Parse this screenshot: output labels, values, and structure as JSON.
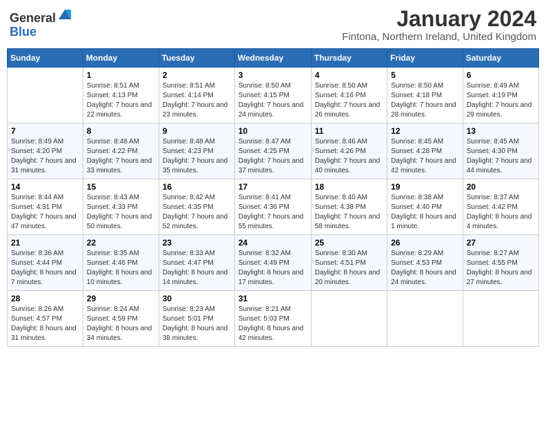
{
  "logo": {
    "text_general": "General",
    "text_blue": "Blue"
  },
  "header": {
    "month": "January 2024",
    "location": "Fintona, Northern Ireland, United Kingdom"
  },
  "weekdays": [
    "Sunday",
    "Monday",
    "Tuesday",
    "Wednesday",
    "Thursday",
    "Friday",
    "Saturday"
  ],
  "weeks": [
    [
      {
        "day": "",
        "sunrise": "",
        "sunset": "",
        "daylight": ""
      },
      {
        "day": "1",
        "sunrise": "Sunrise: 8:51 AM",
        "sunset": "Sunset: 4:13 PM",
        "daylight": "Daylight: 7 hours and 22 minutes."
      },
      {
        "day": "2",
        "sunrise": "Sunrise: 8:51 AM",
        "sunset": "Sunset: 4:14 PM",
        "daylight": "Daylight: 7 hours and 23 minutes."
      },
      {
        "day": "3",
        "sunrise": "Sunrise: 8:50 AM",
        "sunset": "Sunset: 4:15 PM",
        "daylight": "Daylight: 7 hours and 24 minutes."
      },
      {
        "day": "4",
        "sunrise": "Sunrise: 8:50 AM",
        "sunset": "Sunset: 4:16 PM",
        "daylight": "Daylight: 7 hours and 26 minutes."
      },
      {
        "day": "5",
        "sunrise": "Sunrise: 8:50 AM",
        "sunset": "Sunset: 4:18 PM",
        "daylight": "Daylight: 7 hours and 28 minutes."
      },
      {
        "day": "6",
        "sunrise": "Sunrise: 8:49 AM",
        "sunset": "Sunset: 4:19 PM",
        "daylight": "Daylight: 7 hours and 29 minutes."
      }
    ],
    [
      {
        "day": "7",
        "sunrise": "Sunrise: 8:49 AM",
        "sunset": "Sunset: 4:20 PM",
        "daylight": "Daylight: 7 hours and 31 minutes."
      },
      {
        "day": "8",
        "sunrise": "Sunrise: 8:48 AM",
        "sunset": "Sunset: 4:22 PM",
        "daylight": "Daylight: 7 hours and 33 minutes."
      },
      {
        "day": "9",
        "sunrise": "Sunrise: 8:48 AM",
        "sunset": "Sunset: 4:23 PM",
        "daylight": "Daylight: 7 hours and 35 minutes."
      },
      {
        "day": "10",
        "sunrise": "Sunrise: 8:47 AM",
        "sunset": "Sunset: 4:25 PM",
        "daylight": "Daylight: 7 hours and 37 minutes."
      },
      {
        "day": "11",
        "sunrise": "Sunrise: 8:46 AM",
        "sunset": "Sunset: 4:26 PM",
        "daylight": "Daylight: 7 hours and 40 minutes."
      },
      {
        "day": "12",
        "sunrise": "Sunrise: 8:45 AM",
        "sunset": "Sunset: 4:28 PM",
        "daylight": "Daylight: 7 hours and 42 minutes."
      },
      {
        "day": "13",
        "sunrise": "Sunrise: 8:45 AM",
        "sunset": "Sunset: 4:30 PM",
        "daylight": "Daylight: 7 hours and 44 minutes."
      }
    ],
    [
      {
        "day": "14",
        "sunrise": "Sunrise: 8:44 AM",
        "sunset": "Sunset: 4:31 PM",
        "daylight": "Daylight: 7 hours and 47 minutes."
      },
      {
        "day": "15",
        "sunrise": "Sunrise: 8:43 AM",
        "sunset": "Sunset: 4:33 PM",
        "daylight": "Daylight: 7 hours and 50 minutes."
      },
      {
        "day": "16",
        "sunrise": "Sunrise: 8:42 AM",
        "sunset": "Sunset: 4:35 PM",
        "daylight": "Daylight: 7 hours and 52 minutes."
      },
      {
        "day": "17",
        "sunrise": "Sunrise: 8:41 AM",
        "sunset": "Sunset: 4:36 PM",
        "daylight": "Daylight: 7 hours and 55 minutes."
      },
      {
        "day": "18",
        "sunrise": "Sunrise: 8:40 AM",
        "sunset": "Sunset: 4:38 PM",
        "daylight": "Daylight: 7 hours and 58 minutes."
      },
      {
        "day": "19",
        "sunrise": "Sunrise: 8:38 AM",
        "sunset": "Sunset: 4:40 PM",
        "daylight": "Daylight: 8 hours and 1 minute."
      },
      {
        "day": "20",
        "sunrise": "Sunrise: 8:37 AM",
        "sunset": "Sunset: 4:42 PM",
        "daylight": "Daylight: 8 hours and 4 minutes."
      }
    ],
    [
      {
        "day": "21",
        "sunrise": "Sunrise: 8:36 AM",
        "sunset": "Sunset: 4:44 PM",
        "daylight": "Daylight: 8 hours and 7 minutes."
      },
      {
        "day": "22",
        "sunrise": "Sunrise: 8:35 AM",
        "sunset": "Sunset: 4:46 PM",
        "daylight": "Daylight: 8 hours and 10 minutes."
      },
      {
        "day": "23",
        "sunrise": "Sunrise: 8:33 AM",
        "sunset": "Sunset: 4:47 PM",
        "daylight": "Daylight: 8 hours and 14 minutes."
      },
      {
        "day": "24",
        "sunrise": "Sunrise: 8:32 AM",
        "sunset": "Sunset: 4:49 PM",
        "daylight": "Daylight: 8 hours and 17 minutes."
      },
      {
        "day": "25",
        "sunrise": "Sunrise: 8:30 AM",
        "sunset": "Sunset: 4:51 PM",
        "daylight": "Daylight: 8 hours and 20 minutes."
      },
      {
        "day": "26",
        "sunrise": "Sunrise: 8:29 AM",
        "sunset": "Sunset: 4:53 PM",
        "daylight": "Daylight: 8 hours and 24 minutes."
      },
      {
        "day": "27",
        "sunrise": "Sunrise: 8:27 AM",
        "sunset": "Sunset: 4:55 PM",
        "daylight": "Daylight: 8 hours and 27 minutes."
      }
    ],
    [
      {
        "day": "28",
        "sunrise": "Sunrise: 8:26 AM",
        "sunset": "Sunset: 4:57 PM",
        "daylight": "Daylight: 8 hours and 31 minutes."
      },
      {
        "day": "29",
        "sunrise": "Sunrise: 8:24 AM",
        "sunset": "Sunset: 4:59 PM",
        "daylight": "Daylight: 8 hours and 34 minutes."
      },
      {
        "day": "30",
        "sunrise": "Sunrise: 8:23 AM",
        "sunset": "Sunset: 5:01 PM",
        "daylight": "Daylight: 8 hours and 38 minutes."
      },
      {
        "day": "31",
        "sunrise": "Sunrise: 8:21 AM",
        "sunset": "Sunset: 5:03 PM",
        "daylight": "Daylight: 8 hours and 42 minutes."
      },
      {
        "day": "",
        "sunrise": "",
        "sunset": "",
        "daylight": ""
      },
      {
        "day": "",
        "sunrise": "",
        "sunset": "",
        "daylight": ""
      },
      {
        "day": "",
        "sunrise": "",
        "sunset": "",
        "daylight": ""
      }
    ]
  ]
}
